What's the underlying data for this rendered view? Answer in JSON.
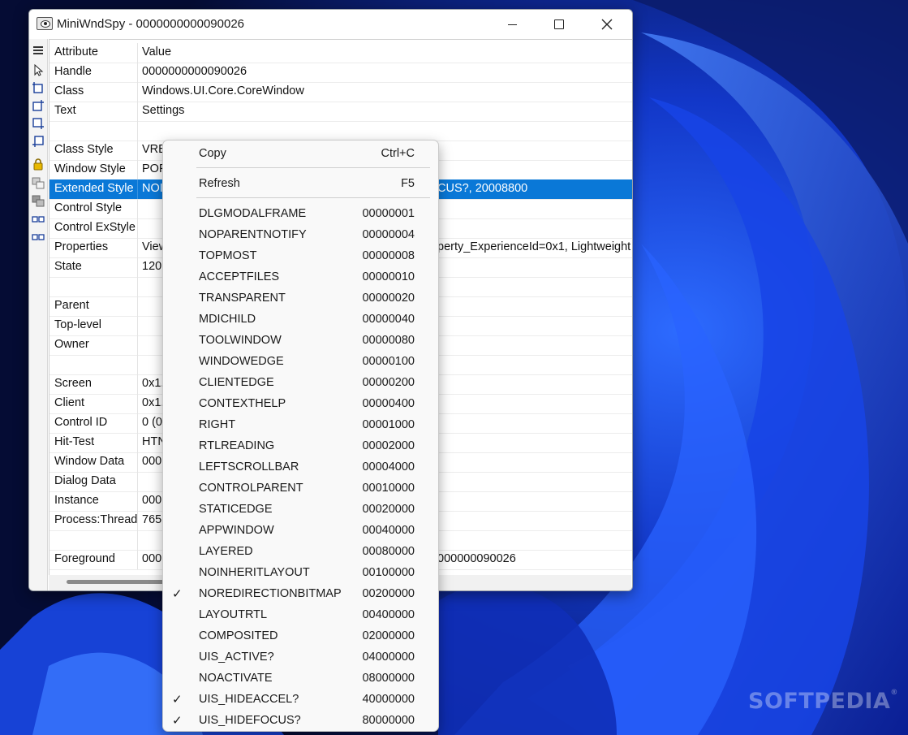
{
  "window": {
    "title": "MiniWndSpy - 0000000000090026"
  },
  "grid": {
    "header": {
      "attr": "Attribute",
      "value": "Value"
    },
    "rows": [
      {
        "attr": "Handle",
        "value": "0000000000090026"
      },
      {
        "attr": "Class",
        "value": "Windows.UI.Core.CoreWindow"
      },
      {
        "attr": "Text",
        "value": "Settings"
      },
      {
        "attr": "",
        "value": ""
      },
      {
        "attr": "Class Style",
        "value": "VRE"
      },
      {
        "attr": "Window Style",
        "value": "POP"
      },
      {
        "attr": "Extended Style",
        "value": "NOI",
        "value_right": "CUS?, 20008800"
      },
      {
        "attr": "Control Style",
        "value": ""
      },
      {
        "attr": "Control ExStyle",
        "value": ""
      },
      {
        "attr": "Properties",
        "value": "View",
        "value_right": "perty_ExperienceId=0x1, Lightweight"
      },
      {
        "attr": "State",
        "value": "120"
      },
      {
        "attr": "",
        "value": ""
      },
      {
        "attr": "Parent",
        "value": ""
      },
      {
        "attr": "Top-level",
        "value": ""
      },
      {
        "attr": "Owner",
        "value": ""
      },
      {
        "attr": "",
        "value": ""
      },
      {
        "attr": "Screen",
        "value": "0x1."
      },
      {
        "attr": "Client",
        "value": "0x1."
      },
      {
        "attr": "Control ID",
        "value": "0 (0"
      },
      {
        "attr": "Hit-Test",
        "value": "HTN"
      },
      {
        "attr": "Window Data",
        "value": "000"
      },
      {
        "attr": "Dialog Data",
        "value": ""
      },
      {
        "attr": "Instance",
        "value": "000"
      },
      {
        "attr": "Process:Thread",
        "value": "765"
      },
      {
        "attr": "",
        "value": ""
      },
      {
        "attr": "Foreground",
        "value": "000",
        "value_right": "000000090026"
      }
    ]
  },
  "menu": {
    "top_items": [
      {
        "label": "Copy",
        "shortcut": "Ctrl+C"
      },
      {
        "label": "Refresh",
        "shortcut": "F5"
      }
    ],
    "flags": [
      {
        "label": "DLGMODALFRAME",
        "value": "00000001",
        "checked": false
      },
      {
        "label": "NOPARENTNOTIFY",
        "value": "00000004",
        "checked": false
      },
      {
        "label": "TOPMOST",
        "value": "00000008",
        "checked": false
      },
      {
        "label": "ACCEPTFILES",
        "value": "00000010",
        "checked": false
      },
      {
        "label": "TRANSPARENT",
        "value": "00000020",
        "checked": false
      },
      {
        "label": "MDICHILD",
        "value": "00000040",
        "checked": false
      },
      {
        "label": "TOOLWINDOW",
        "value": "00000080",
        "checked": false
      },
      {
        "label": "WINDOWEDGE",
        "value": "00000100",
        "checked": false
      },
      {
        "label": "CLIENTEDGE",
        "value": "00000200",
        "checked": false
      },
      {
        "label": "CONTEXTHELP",
        "value": "00000400",
        "checked": false
      },
      {
        "label": "RIGHT",
        "value": "00001000",
        "checked": false
      },
      {
        "label": "RTLREADING",
        "value": "00002000",
        "checked": false
      },
      {
        "label": "LEFTSCROLLBAR",
        "value": "00004000",
        "checked": false
      },
      {
        "label": "CONTROLPARENT",
        "value": "00010000",
        "checked": false
      },
      {
        "label": "STATICEDGE",
        "value": "00020000",
        "checked": false
      },
      {
        "label": "APPWINDOW",
        "value": "00040000",
        "checked": false
      },
      {
        "label": "LAYERED",
        "value": "00080000",
        "checked": false
      },
      {
        "label": "NOINHERITLAYOUT",
        "value": "00100000",
        "checked": false
      },
      {
        "label": "NOREDIRECTIONBITMAP",
        "value": "00200000",
        "checked": true
      },
      {
        "label": "LAYOUTRTL",
        "value": "00400000",
        "checked": false
      },
      {
        "label": "COMPOSITED",
        "value": "02000000",
        "checked": false
      },
      {
        "label": "UIS_ACTIVE?",
        "value": "04000000",
        "checked": false
      },
      {
        "label": "NOACTIVATE",
        "value": "08000000",
        "checked": false
      },
      {
        "label": "UIS_HIDEACCEL?",
        "value": "40000000",
        "checked": true
      },
      {
        "label": "UIS_HIDEFOCUS?",
        "value": "80000000",
        "checked": true
      }
    ],
    "check_glyph": "✓"
  },
  "watermark": {
    "text": "SOFTPEDIA",
    "mark": "®"
  },
  "colors": {
    "selection": "#0a78d7",
    "wallpaper_dark": "#06103a",
    "wallpaper_blue": "#1a4fe0"
  }
}
